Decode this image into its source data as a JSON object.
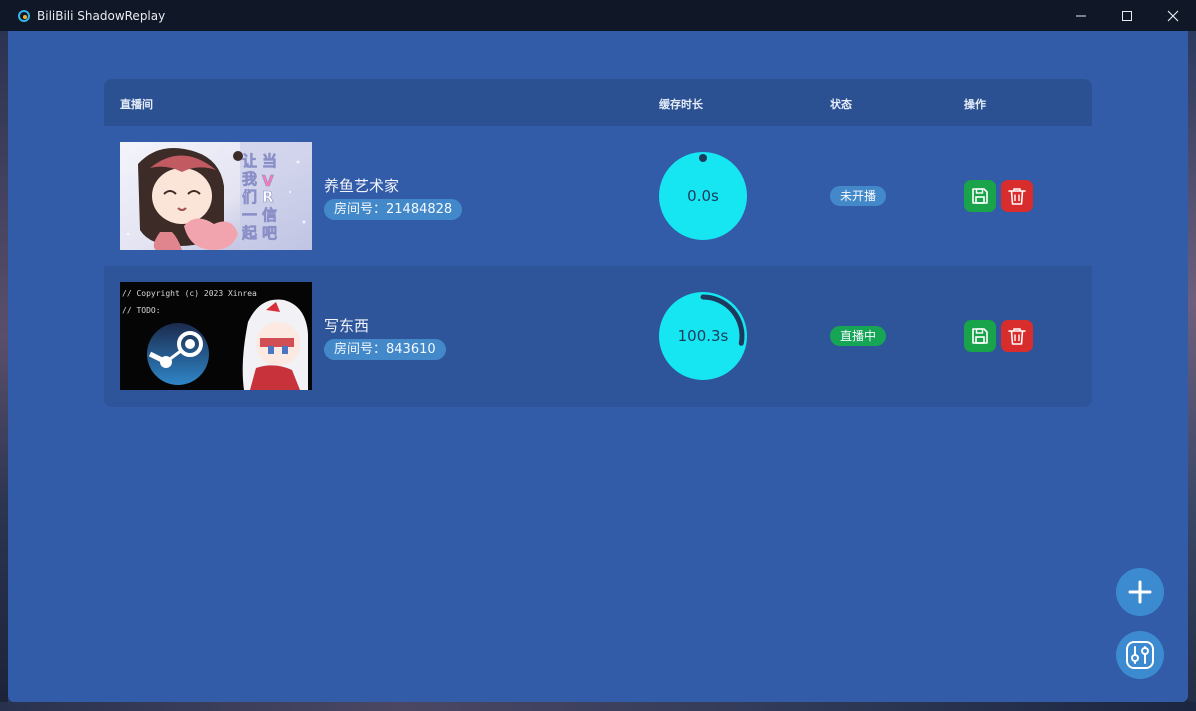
{
  "window": {
    "title": "BiliBili ShadowReplay"
  },
  "table": {
    "headers": {
      "room": "直播间",
      "cache": "缓存时长",
      "status": "状态",
      "actions": "操作"
    },
    "rows": [
      {
        "title": "养鱼艺术家",
        "room_id": "房间号：21484828",
        "cache_label": "0.0s",
        "cache_progress": 0,
        "status": "未开播",
        "live": false,
        "cover_text": "当VR让我们一起信吧"
      },
      {
        "title": "写东西",
        "room_id": "房间号：843610",
        "cache_label": "100.3s",
        "cache_progress": 0.28,
        "status": "直播中",
        "live": true,
        "cover_text_line1": "// Copyright (c) 2023 Xinrea",
        "cover_text_line2": "// TODO:"
      }
    ]
  },
  "colors": {
    "accent": "#325ca8",
    "gauge": "#16e6f2",
    "save": "#19a34a",
    "delete": "#d92c2c",
    "live": "#16a455"
  },
  "icons": {
    "add": "plus-icon",
    "settings": "sliders-icon",
    "save": "save-icon",
    "delete": "trash-icon"
  }
}
